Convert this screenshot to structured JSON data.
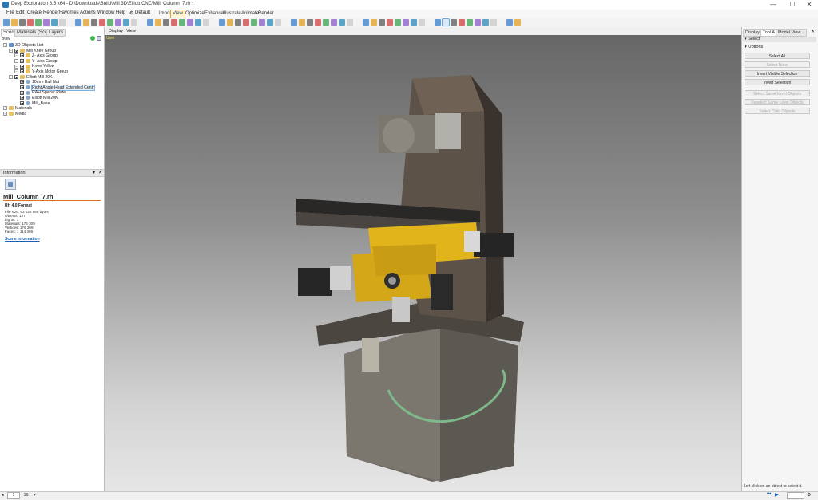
{
  "window": {
    "title": "Deep Exploration 6.5 x64 - D:\\Downloads\\Build\\Mill 3D\\Elliott CNC\\Mill_Column_7.rh *",
    "min": "—",
    "max": "☐",
    "close": "✕"
  },
  "menu": [
    "File",
    "Edit",
    "Create",
    "Render",
    "Favorites",
    "Actions",
    "Window",
    "Help",
    "Default"
  ],
  "modes": [
    "Import",
    "View",
    "Optimize",
    "Enhance",
    "Illustrate",
    "Animate",
    "Render"
  ],
  "modes_active": "View",
  "left_tabs": [
    "Scene",
    "Materials (Scene)",
    "Layers"
  ],
  "left_subtab": "BOM",
  "viewport_tabs": [
    "Display",
    "View"
  ],
  "viewport_label": "User",
  "tree": [
    {
      "label": "3D Objects List",
      "depth": 0,
      "kind": "group"
    },
    {
      "label": "Mill Knee Group",
      "depth": 1,
      "kind": "folder"
    },
    {
      "label": "Z- Axis Group",
      "depth": 2,
      "kind": "folder"
    },
    {
      "label": "Y- Axis Group",
      "depth": 2,
      "kind": "folder"
    },
    {
      "label": "Knee Yellow",
      "depth": 2,
      "kind": "folder"
    },
    {
      "label": "Y-Axis Motor Group",
      "depth": 2,
      "kind": "folder"
    },
    {
      "label": "Elliott Mill 20K",
      "depth": 1,
      "kind": "folder"
    },
    {
      "label": "10mm Ball Nut",
      "depth": 2,
      "kind": "obj"
    },
    {
      "label": "Right Angle Head Extended Centr",
      "depth": 2,
      "kind": "obj",
      "highlight": true
    },
    {
      "label": "RAH Spacer Plate",
      "depth": 2,
      "kind": "obj"
    },
    {
      "label": "Elliott Mill 20K",
      "depth": 2,
      "kind": "obj"
    },
    {
      "label": "Mill_Base",
      "depth": 2,
      "kind": "obj"
    },
    {
      "label": "Materials",
      "depth": 0,
      "kind": "folder"
    },
    {
      "label": "Media",
      "depth": 0,
      "kind": "folder"
    }
  ],
  "info": {
    "header": "Information",
    "filename": "Mill_Column_7.rh",
    "format": "RH 4.0 Format",
    "rows": [
      "File size:   63 025 968 bytes",
      "Objects:   127",
      "Lights:   1",
      "Materials:   176 309",
      "Vertices:   176 309",
      "Faces:   1 114 396"
    ],
    "link": "Scene information"
  },
  "right_tabs": [
    "Display...",
    "Tool A...",
    "Model View..."
  ],
  "right_panel": {
    "title": "Select",
    "section": "Options",
    "buttons": [
      {
        "label": "Select All",
        "enabled": true
      },
      {
        "label": "Select None",
        "enabled": false
      },
      {
        "label": "Invert Visible Selection",
        "enabled": true
      },
      {
        "label": "Invert Selection",
        "enabled": true
      },
      {
        "label": "Select Same Level Objects",
        "enabled": false
      },
      {
        "label": "Deselect Same Level Objects",
        "enabled": false
      },
      {
        "label": "Select Child Objects",
        "enabled": false
      }
    ]
  },
  "status": {
    "hint": "Left click on an object to select it.",
    "page": "1",
    "of": "26"
  },
  "colors": {
    "accent": "#f0a020",
    "selection": "#3a8fd8",
    "yellow_part": "#e2b41c"
  }
}
